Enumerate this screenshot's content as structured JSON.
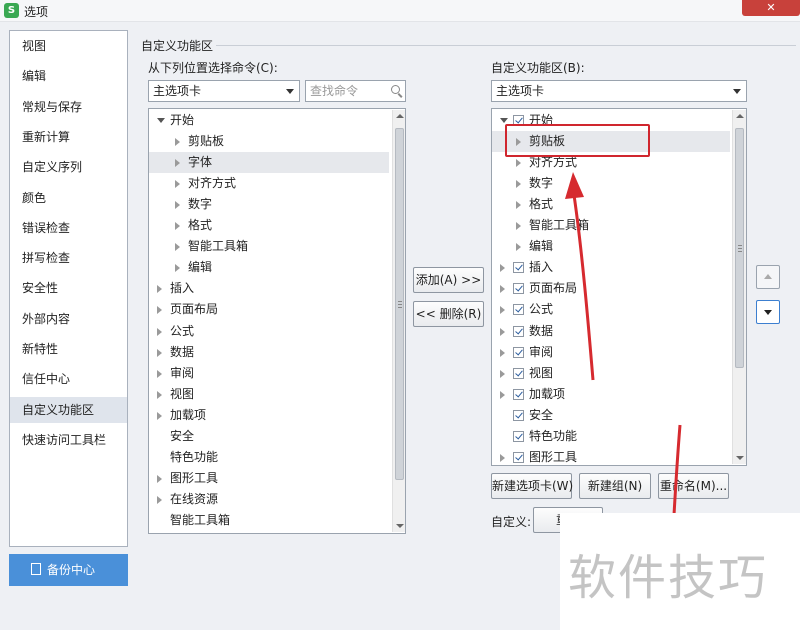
{
  "window": {
    "title": "选项",
    "app_icon": "S",
    "close_glyph": "✕"
  },
  "nav": {
    "items": [
      {
        "label": "视图"
      },
      {
        "label": "编辑"
      },
      {
        "label": "常规与保存"
      },
      {
        "label": "重新计算"
      },
      {
        "label": "自定义序列"
      },
      {
        "label": "颜色"
      },
      {
        "label": "错误检查"
      },
      {
        "label": "拼写检查"
      },
      {
        "label": "安全性"
      },
      {
        "label": "外部内容"
      },
      {
        "label": "新特性"
      },
      {
        "label": "信任中心"
      },
      {
        "label": "自定义功能区",
        "selected": true
      },
      {
        "label": "快速访问工具栏"
      }
    ],
    "backup_label": "备份中心"
  },
  "section_title": "自定义功能区",
  "left": {
    "label": "从下列位置选择命令(C):",
    "combo_value": "主选项卡",
    "search_placeholder": "查找命令",
    "items": [
      {
        "label": "开始",
        "level": 0,
        "expander": "expanded"
      },
      {
        "label": "剪贴板",
        "level": 1,
        "expander": "collapsed"
      },
      {
        "label": "字体",
        "level": 1,
        "expander": "collapsed",
        "selected": true
      },
      {
        "label": "对齐方式",
        "level": 1,
        "expander": "collapsed"
      },
      {
        "label": "数字",
        "level": 1,
        "expander": "collapsed"
      },
      {
        "label": "格式",
        "level": 1,
        "expander": "collapsed"
      },
      {
        "label": "智能工具箱",
        "level": 1,
        "expander": "collapsed"
      },
      {
        "label": "编辑",
        "level": 1,
        "expander": "collapsed"
      },
      {
        "label": "插入",
        "level": 0,
        "expander": "collapsed"
      },
      {
        "label": "页面布局",
        "level": 0,
        "expander": "collapsed"
      },
      {
        "label": "公式",
        "level": 0,
        "expander": "collapsed"
      },
      {
        "label": "数据",
        "level": 0,
        "expander": "collapsed"
      },
      {
        "label": "审阅",
        "level": 0,
        "expander": "collapsed"
      },
      {
        "label": "视图",
        "level": 0,
        "expander": "collapsed"
      },
      {
        "label": "加载项",
        "level": 0,
        "expander": "collapsed"
      },
      {
        "label": "安全",
        "level": 0,
        "expander": "none"
      },
      {
        "label": "特色功能",
        "level": 0,
        "expander": "none"
      },
      {
        "label": "图形工具",
        "level": 0,
        "expander": "collapsed"
      },
      {
        "label": "在线资源",
        "level": 0,
        "expander": "collapsed"
      },
      {
        "label": "智能工具箱",
        "level": 0,
        "expander": "none"
      }
    ]
  },
  "middle": {
    "add_label": "添加(A) >>",
    "remove_label": "<< 删除(R)"
  },
  "right": {
    "label": "自定义功能区(B):",
    "combo_value": "主选项卡",
    "items": [
      {
        "label": "开始",
        "level": 0,
        "expander": "expanded",
        "checked": true
      },
      {
        "label": "剪贴板",
        "level": 1,
        "expander": "collapsed",
        "selected": true
      },
      {
        "label": "对齐方式",
        "level": 1,
        "expander": "collapsed"
      },
      {
        "label": "数字",
        "level": 1,
        "expander": "collapsed"
      },
      {
        "label": "格式",
        "level": 1,
        "expander": "collapsed"
      },
      {
        "label": "智能工具箱",
        "level": 1,
        "expander": "collapsed"
      },
      {
        "label": "编辑",
        "level": 1,
        "expander": "collapsed"
      },
      {
        "label": "插入",
        "level": 0,
        "expander": "collapsed",
        "checked": true
      },
      {
        "label": "页面布局",
        "level": 0,
        "expander": "collapsed",
        "checked": true
      },
      {
        "label": "公式",
        "level": 0,
        "expander": "collapsed",
        "checked": true
      },
      {
        "label": "数据",
        "level": 0,
        "expander": "collapsed",
        "checked": true
      },
      {
        "label": "审阅",
        "level": 0,
        "expander": "collapsed",
        "checked": true
      },
      {
        "label": "视图",
        "level": 0,
        "expander": "collapsed",
        "checked": true
      },
      {
        "label": "加载项",
        "level": 0,
        "expander": "collapsed",
        "checked": true
      },
      {
        "label": "安全",
        "level": 0,
        "expander": "none",
        "checked": true
      },
      {
        "label": "特色功能",
        "level": 0,
        "expander": "none",
        "checked": true
      },
      {
        "label": "图形工具",
        "level": 0,
        "expander": "collapsed",
        "checked": true
      }
    ],
    "new_tab_label": "新建选项卡(W)",
    "new_group_label": "新建组(N)",
    "rename_label": "重命名(M)...",
    "custom_label": "自定义:",
    "reset_label": "重置"
  },
  "watermark": "软件技巧",
  "colors": {
    "accent": "#4a90d9",
    "highlight": "#d0262e",
    "close": "#c8413b"
  }
}
